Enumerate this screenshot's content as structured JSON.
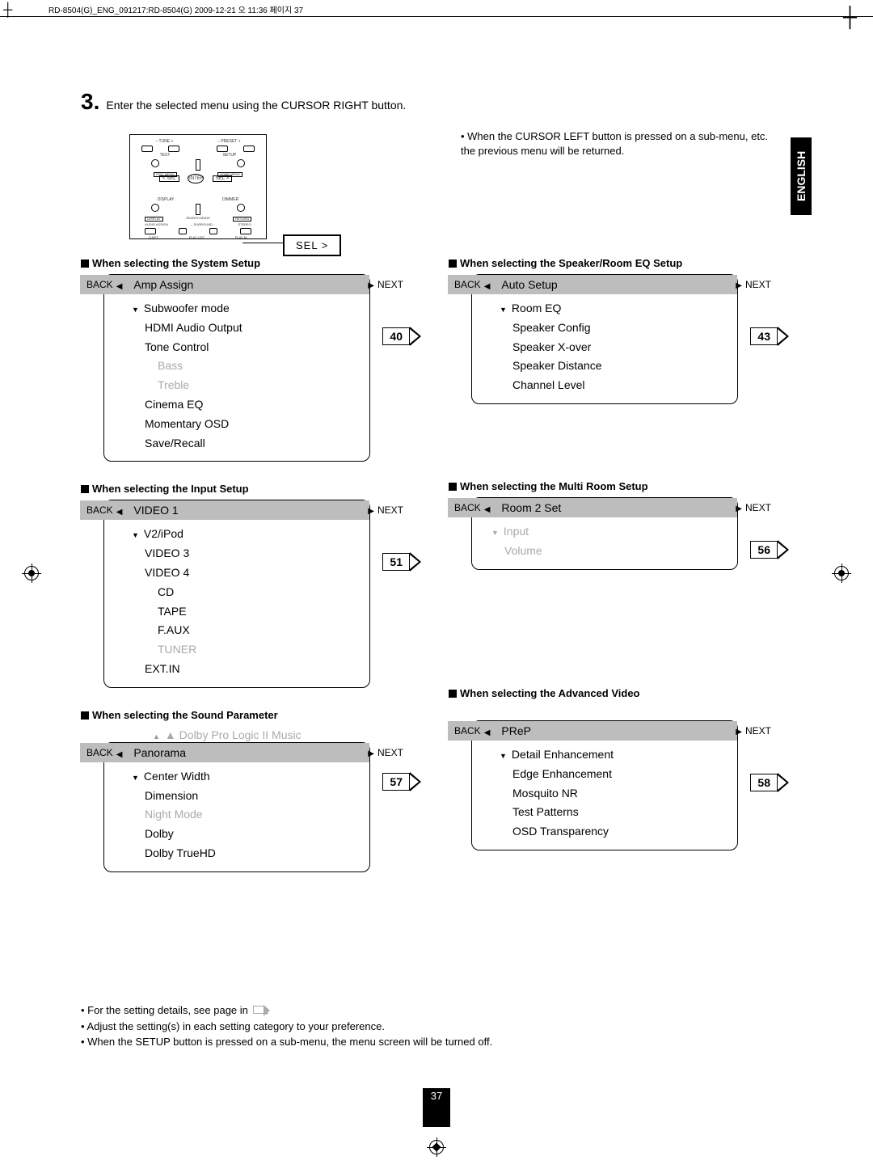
{
  "header_text": "RD-8504(G)_ENG_091217:RD-8504(G)  2009-12-21  오  11:36  페이지 37",
  "step": {
    "num": "3.",
    "text": "Enter the selected menu using the CURSOR RIGHT button."
  },
  "remote": {
    "top_labels": [
      "– TUNE +",
      "– PRESET +"
    ],
    "row2_left": "TEST",
    "row2_right": "SETUP",
    "row2_box_left": "DISC MENU",
    "row2_box_right": "HOME MENU",
    "sel_left": "< SEL",
    "sel_center": "ENTER",
    "sel_right": "SEL >",
    "row4_left": "DISPLAY",
    "row4_right": "DIMMER",
    "row4_box_left": "DISPLAY",
    "row4_center": "SEARCH MODE",
    "row4_box_right": "RETURN",
    "row5": [
      "AUDIO ASSIGN",
      "– SURROUND –",
      "STEREO"
    ],
    "row6": [
      "Q.RPT",
      "PLAY LIST",
      "PLAY M."
    ],
    "callout": "SEL >"
  },
  "side_tab": "ENGLISH",
  "note_right": "• When the CURSOR LEFT button is pressed on a sub-menu, etc. the previous menu will be returned.",
  "labels": {
    "back": "BACK",
    "next": "NEXT"
  },
  "panels": {
    "system": {
      "title": "When selecting the System Setup",
      "header": "Amp Assign",
      "items": [
        "Subwoofer mode",
        "HDMI Audio Output",
        "Tone Control",
        "Bass",
        "Treble",
        "Cinema EQ",
        "Momentary OSD",
        "Save/Recall"
      ],
      "dim_idx": [
        3,
        4
      ],
      "page": "40"
    },
    "speaker": {
      "title": "When selecting the Speaker/Room EQ Setup",
      "header": "Auto Setup",
      "items": [
        "Room EQ",
        "Speaker Config",
        "Speaker X-over",
        "Speaker Distance",
        "Channel Level"
      ],
      "page": "43"
    },
    "input": {
      "title": "When selecting the Input Setup",
      "header": "VIDEO 1",
      "items": [
        "V2/iPod",
        "VIDEO 3",
        "VIDEO 4",
        "CD",
        "TAPE",
        "F.AUX",
        "TUNER",
        "EXT.IN"
      ],
      "indent_idx": [
        3,
        4,
        5,
        6
      ],
      "dim_idx": [
        6
      ],
      "page": "51"
    },
    "multiroom": {
      "title": "When selecting the Multi Room Setup",
      "header": "Room 2 Set",
      "items": [
        "Input",
        "Volume"
      ],
      "dim_idx": [
        0,
        1
      ],
      "page": "56"
    },
    "sound": {
      "title": "When selecting the Sound Parameter",
      "pre": "Dolby Pro Logic II Music",
      "header": "Panorama",
      "items": [
        "Center Width",
        "Dimension",
        "Night Mode",
        "Dolby",
        "Dolby TrueHD"
      ],
      "dim_idx": [
        2
      ],
      "page": "57"
    },
    "advvideo": {
      "title": "When selecting the Advanced Video",
      "header": "PReP",
      "items": [
        "Detail Enhancement",
        "Edge Enhancement",
        "Mosquito NR",
        "Test Patterns",
        "OSD Transparency"
      ],
      "page": "58"
    }
  },
  "footnotes": [
    "• For the setting details, see page in",
    "• Adjust the setting(s) in each setting category to your preference.",
    "• When the SETUP button is pressed on a sub-menu, the menu screen will be turned off."
  ],
  "page_num": "37"
}
